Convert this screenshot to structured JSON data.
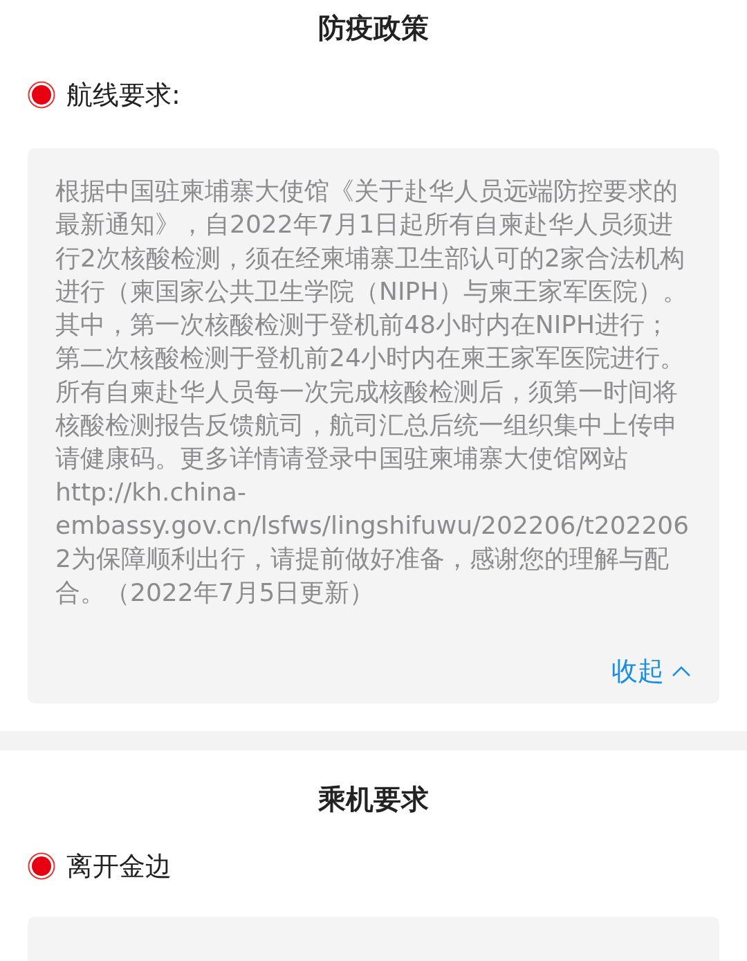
{
  "sections": [
    {
      "title": "防疫政策",
      "items": [
        {
          "label": "航线要求:",
          "panel_shown": true,
          "text": "根据中国驻柬埔寨大使馆《关于赴华人员远端防控要求的最新通知》，自2022年7月1日起所有自柬赴华人员须进行2次核酸检测，须在经柬埔寨卫生部认可的2家合法机构进行（柬国家公共卫生学院（NIPH）与柬王家军医院）。其中，第一次核酸检测于登机前48小时内在NIPH进行；第二次核酸检测于登机前24小时内在柬王家军医院进行。所有自柬赴华人员每一次完成核酸检测后，须第一时间将核酸检测报告反馈航司，航司汇总后统一组织集中上传申请健康码。更多详情请登录中国驻柬埔寨大使馆网站http://kh.china-embassy.gov.cn/lsfws/lingshifuwu/202206/t2022062为保障顺利出行，请提前做好准备，感谢您的理解与配合。（2022年7月5日更新）",
          "toggle": "收起",
          "expanded": true
        }
      ]
    },
    {
      "title": "乘机要求",
      "items": [
        {
          "label": "离开金边",
          "panel_shown": true
        }
      ]
    }
  ]
}
